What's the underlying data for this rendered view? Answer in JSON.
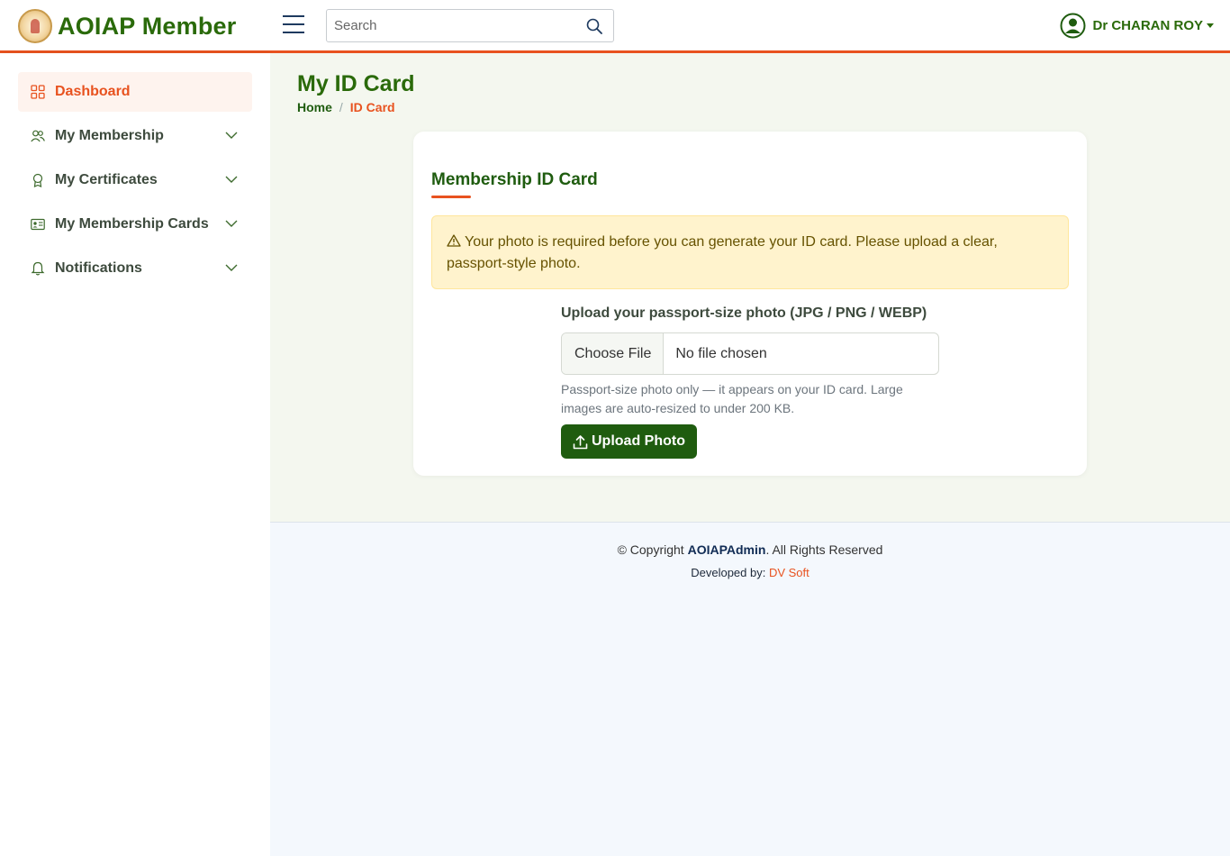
{
  "header": {
    "brand": "AOIAP Member",
    "search_placeholder": "Search",
    "user_name": "Dr CHARAN ROY"
  },
  "sidebar": {
    "items": [
      {
        "label": "Dashboard",
        "icon": "grid-icon",
        "active": true
      },
      {
        "label": "My Membership",
        "icon": "users-icon"
      },
      {
        "label": "My Certificates",
        "icon": "award-icon"
      },
      {
        "label": "My Membership Cards",
        "icon": "id-card-icon"
      },
      {
        "label": "Notifications",
        "icon": "bell-icon"
      }
    ]
  },
  "page": {
    "title": "My ID Card",
    "breadcrumb": {
      "home": "Home",
      "separator": "/",
      "current": "ID Card"
    }
  },
  "card": {
    "title": "Membership ID Card",
    "alert": "Your photo is required before you can generate your ID card. Please upload a clear, passport-style photo.",
    "upload_label": "Upload your passport-size photo (JPG / PNG / WEBP)",
    "file_button": "Choose File",
    "file_status": "No file chosen",
    "help": "Passport-size photo only — it appears on your ID card. Large images are auto-resized to under 200 KB.",
    "submit_label": "Upload Photo"
  },
  "footer": {
    "copyright_prefix": "© Copyright ",
    "company": "AOIAPAdmin",
    "copyright_suffix": ". All Rights Reserved",
    "developed_prefix": "Developed by: ",
    "developer": "DV Soft"
  },
  "colors": {
    "brand_green": "#2a6a0a",
    "accent_orange": "#e8521f",
    "alert_bg": "#fff3cd"
  }
}
